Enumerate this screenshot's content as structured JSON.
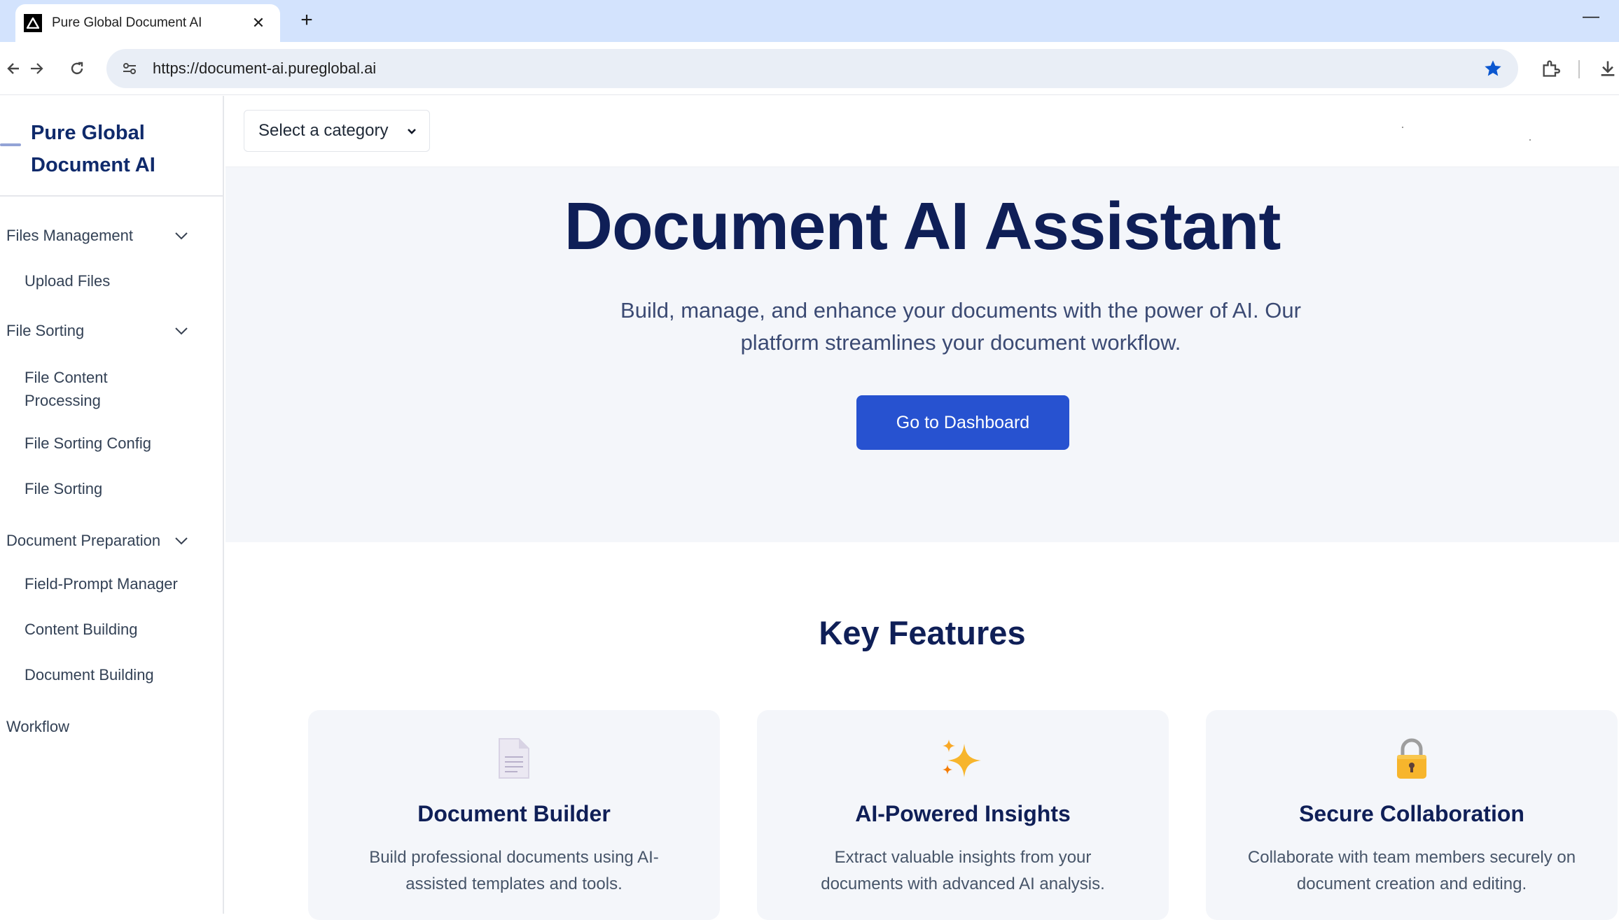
{
  "browser": {
    "tab_title": "Pure Global Document AI",
    "url": "https://document-ai.pureglobal.ai"
  },
  "sidebar": {
    "brand": "Pure Global Document AI",
    "sections": [
      {
        "label": "Files Management",
        "items": [
          "Upload Files"
        ]
      },
      {
        "label": "File Sorting",
        "items": [
          "File Content Processing",
          "File Sorting Config",
          "File Sorting"
        ]
      },
      {
        "label": "Document Preparation",
        "items": [
          "Field-Prompt Manager",
          "Content Building",
          "Document Building"
        ]
      },
      {
        "label": "Workflow",
        "items": []
      }
    ]
  },
  "topbar": {
    "category_select": "Select a category"
  },
  "hero": {
    "title": "Document AI Assistant",
    "subtitle": "Build, manage, and enhance your documents with the power of AI. Our platform streamlines your document workflow.",
    "cta": "Go to Dashboard"
  },
  "features": {
    "heading": "Key Features",
    "cards": [
      {
        "icon": "document-icon",
        "title": "Document Builder",
        "description": "Build professional documents using AI-assisted templates and tools."
      },
      {
        "icon": "sparkles-icon",
        "title": "AI-Powered Insights",
        "description": "Extract valuable insights from your documents with advanced AI analysis."
      },
      {
        "icon": "lock-icon",
        "title": "Secure Collaboration",
        "description": "Collaborate with team members securely on document creation and editing."
      }
    ]
  },
  "colors": {
    "accent": "#2752d0",
    "heading": "#0f1f57",
    "hero_background": "#f4f6fa",
    "browser_frame": "#d3e3fd"
  }
}
